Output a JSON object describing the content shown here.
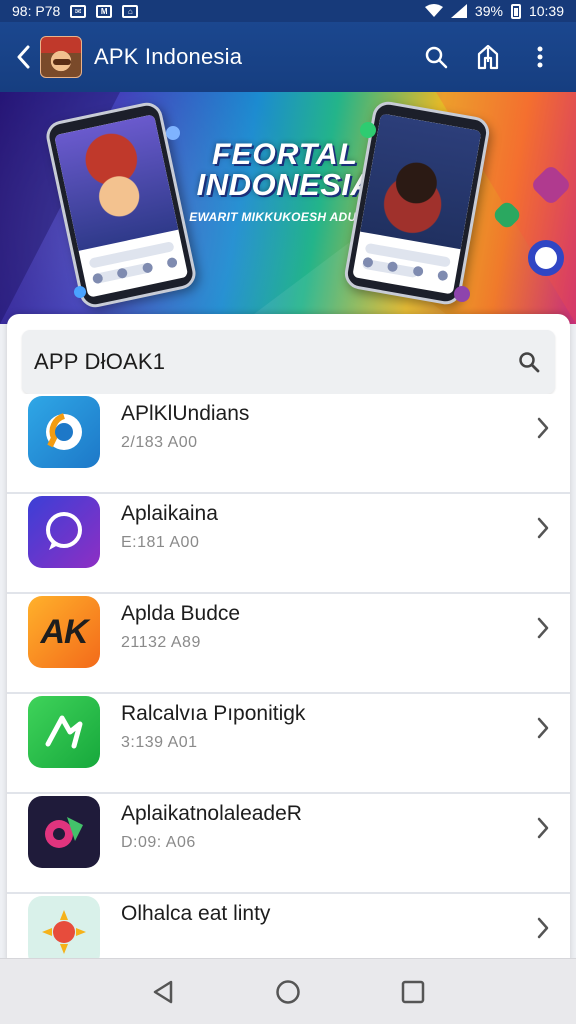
{
  "status_bar": {
    "time_left": "98: P78",
    "battery": "39%",
    "clock": "10:39"
  },
  "app_bar": {
    "title": "APK Indonesia"
  },
  "banner": {
    "title_line1": "FEORTAL",
    "title_line2": "INDONESIA",
    "subtitle": "EWARIT MIKKUKOESH ADUSAA"
  },
  "search": {
    "text": "APP DłOAK1"
  },
  "apps": [
    {
      "name": "APlKlUndians",
      "sub": "2/183 A00",
      "icon": "chat-blue-orange-icon"
    },
    {
      "name": "Aplaikaina",
      "sub": "E:181 A00",
      "icon": "chat-purple-icon"
    },
    {
      "name": "Aplda Budce",
      "sub": "21132 A89",
      "icon": "ak-orange-icon",
      "icon_text": "AK"
    },
    {
      "name": "Ralcalvıa Pıponitigk",
      "sub": "3:139 A01",
      "icon": "green-arrow-icon"
    },
    {
      "name": "AplaikatnolaleadeR",
      "sub": "D:09: A06",
      "icon": "flower-dark-icon"
    },
    {
      "name": "Olhalca eat linty",
      "sub": "",
      "icon": "sun-yellow-icon"
    }
  ],
  "colors": {
    "appbar": "#1b478f",
    "accent": "#2a5bd7"
  }
}
